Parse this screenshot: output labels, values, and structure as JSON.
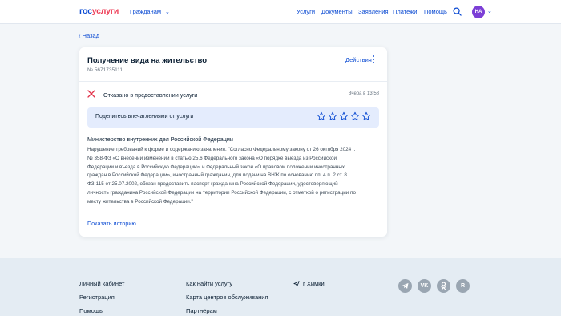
{
  "header": {
    "logo_gos": "гос",
    "logo_uslugi": "услуги",
    "citizens": "Гражданам",
    "nav": [
      "Услуги",
      "Документы",
      "Заявления",
      "Платежи",
      "Помощь"
    ],
    "avatar_initials": "НА"
  },
  "back_label": "Назад",
  "card": {
    "title": "Получение вида на жительство",
    "number": "№ 5671735111",
    "actions_label": "Действия",
    "status_text": "Отказано в предоставлении услуги",
    "status_time": "Вчера в 13:58",
    "feedback_prompt": "Поделитесь впечатлениями от услуги",
    "rating_max": 5,
    "ministry": "Министерство внутренних дел Российской Федерации",
    "body_lines": [
      "Нарушение требований к форме и содержанию заявления. \"Согласно Федеральному закону от 26 октября 2024 г.",
      "№ 358-ФЗ «О внесении изменений в статью 25.6 Федерального закона «О порядке выезда из Российской",
      "Федерации и въезда в Российскую Федерацию» и Федеральный закон «О правовом положении иностранных",
      "граждан в Российской Федерации», иностранный гражданин, для подачи на ВНЖ по основанию пп. 4 п. 2 ст. 8",
      "ФЗ-115 от 25.07.2002, обязан предоставить паспорт гражданина Российской Федерации, удостоверяющий",
      "личность гражданина Российской Федерации на территории Российской Федерации, с отметкой о регистрации по",
      "месту жительства в Российской Федерации.\""
    ],
    "history_link": "Показать историю"
  },
  "footer": {
    "col1": [
      "Личный кабинет",
      "Регистрация",
      "Помощь"
    ],
    "col2": [
      "Как найти услугу",
      "Карта центров обслуживания",
      "Партнёрам"
    ],
    "location": "г Химки",
    "social_icons": [
      "telegram-icon",
      "vk-icon",
      "ok-icon",
      "rutube-icon"
    ]
  },
  "colors": {
    "brand_blue": "#0d4cd3",
    "brand_red": "#ee3f58",
    "error_red": "#e2334a",
    "avatar_purple": "#7c3fd6",
    "feedback_bg": "#e4ecfd"
  }
}
